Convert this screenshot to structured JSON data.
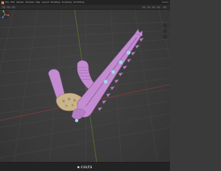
{
  "menu": {
    "items": [
      "File",
      "Edit",
      "Render",
      "Window",
      "Help",
      "Layout",
      "Modeling",
      "Sculpting",
      "UV Editing"
    ],
    "right_label": "Scene"
  },
  "viewport": {
    "object": "chainsword-arm-model",
    "colors": {
      "background": "#3c3c3c",
      "grid": "#4a4a4a",
      "x_axis": "#8a3b3b",
      "y_axis": "#5b7a2c",
      "model_primary": "#c38bd0",
      "model_shadow": "#9a67ab",
      "model_detail": "#c9b38a",
      "gem": "#a9d3e6"
    }
  },
  "status": {
    "watermark": "CULTS"
  }
}
